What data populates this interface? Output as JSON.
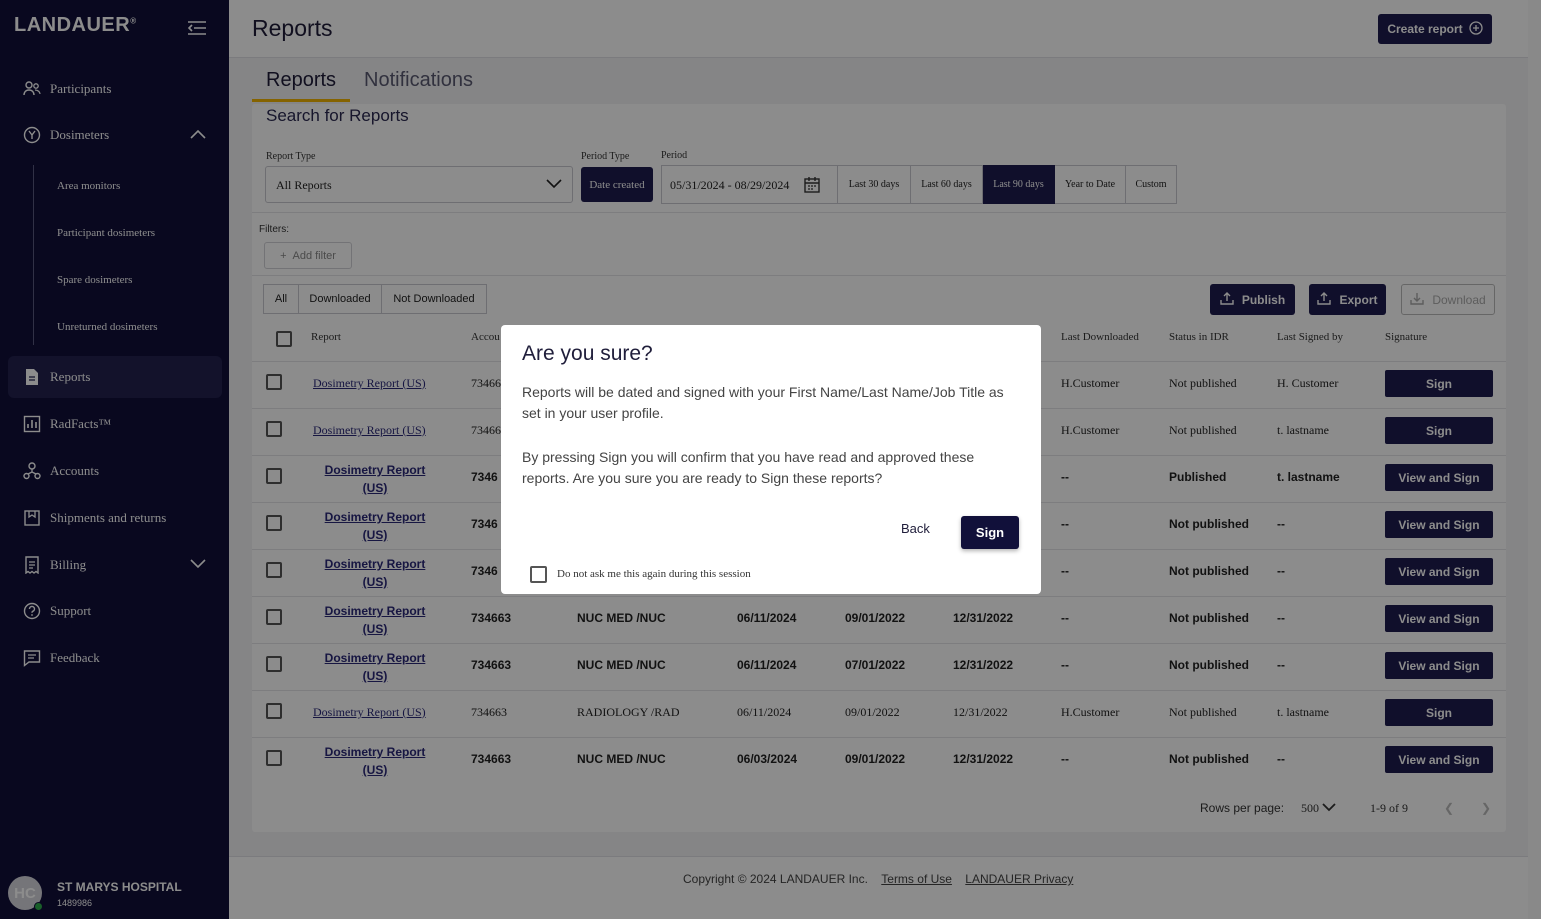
{
  "sidebar": {
    "logo": "LANDAUER",
    "logo_mark": "®",
    "items": [
      {
        "label": "Participants",
        "icon": "participants-icon"
      },
      {
        "label": "Dosimeters",
        "icon": "dosimeter-icon"
      },
      {
        "label": "Reports",
        "icon": "report-icon"
      },
      {
        "label": "RadFacts™",
        "icon": "chart-icon"
      },
      {
        "label": "Accounts",
        "icon": "accounts-icon"
      },
      {
        "label": "Shipments and returns",
        "icon": "shipment-icon"
      },
      {
        "label": "Billing",
        "icon": "billing-icon"
      },
      {
        "label": "Support",
        "icon": "help-icon"
      },
      {
        "label": "Feedback",
        "icon": "feedback-icon"
      }
    ],
    "dosimeter_sub": [
      "Area monitors",
      "Participant dosimeters",
      "Spare dosimeters",
      "Unreturned dosimeters"
    ],
    "user": {
      "initials": "HC",
      "name": "ST MARYS HOSPITAL",
      "id": "1489986"
    }
  },
  "header": {
    "title": "Reports",
    "create_label": "Create report"
  },
  "tabs": [
    "Reports",
    "Notifications"
  ],
  "search": {
    "title": "Search for Reports",
    "report_type_label": "Report Type",
    "report_type_value": "All Reports",
    "period_type_label": "Period Type",
    "period_type_value": "Date created",
    "period_label": "Period",
    "period_value": "05/31/2024 - 08/29/2024",
    "ranges": [
      "Last 30 days",
      "Last 60 days",
      "Last 90 days",
      "Year to Date",
      "Custom"
    ],
    "selected_range": "Last 90 days",
    "filters_label": "Filters:",
    "add_filter": "Add filter"
  },
  "download_filter": [
    "All",
    "Downloaded",
    "Not Downloaded"
  ],
  "actions": {
    "publish": "Publish",
    "export": "Export",
    "download": "Download"
  },
  "table": {
    "headers": [
      "Report",
      "Accou",
      "Last Downloaded",
      "Status in IDR",
      "Last Signed by",
      "Signature"
    ],
    "rows": [
      {
        "report": "Dosimetry Report (US)",
        "acct": "73466",
        "c3": "",
        "c4": "",
        "c5": "",
        "c6": "",
        "last_dl": "H.Customer",
        "status": "Not published",
        "signed": "H. Customer",
        "action": "Sign",
        "bold": false
      },
      {
        "report": "Dosimetry Report (US)",
        "acct": "73466",
        "c3": "",
        "c4": "",
        "c5": "",
        "c6": "",
        "last_dl": "H.Customer",
        "status": "Not published",
        "signed": "t. lastname",
        "action": "Sign",
        "bold": false
      },
      {
        "report": "Dosimetry Report (US)",
        "acct": "7346",
        "c3": "",
        "c4": "",
        "c5": "",
        "c6": "",
        "last_dl": "--",
        "status": "Published",
        "signed": "t. lastname",
        "action": "View and Sign",
        "bold": true
      },
      {
        "report": "Dosimetry Report (US)",
        "acct": "7346",
        "c3": "",
        "c4": "",
        "c5": "",
        "c6": "",
        "last_dl": "--",
        "status": "Not published",
        "signed": "--",
        "action": "View and Sign",
        "bold": true
      },
      {
        "report": "Dosimetry Report (US)",
        "acct": "7346",
        "c3": "",
        "c4": "",
        "c5": "",
        "c6": "",
        "last_dl": "--",
        "status": "Not published",
        "signed": "--",
        "action": "View and Sign",
        "bold": true
      },
      {
        "report": "Dosimetry Report (US)",
        "acct": "734663",
        "c3": "NUC MED /NUC",
        "c4": "06/11/2024",
        "c5": "09/01/2022",
        "c6": "12/31/2022",
        "last_dl": "--",
        "status": "Not published",
        "signed": "--",
        "action": "View and Sign",
        "bold": true
      },
      {
        "report": "Dosimetry Report (US)",
        "acct": "734663",
        "c3": "NUC MED /NUC",
        "c4": "06/11/2024",
        "c5": "07/01/2022",
        "c6": "12/31/2022",
        "last_dl": "--",
        "status": "Not published",
        "signed": "--",
        "action": "View and Sign",
        "bold": true
      },
      {
        "report": "Dosimetry Report (US)",
        "acct": "734663",
        "c3": "RADIOLOGY /RAD",
        "c4": "06/11/2024",
        "c5": "09/01/2022",
        "c6": "12/31/2022",
        "last_dl": "H.Customer",
        "status": "Not published",
        "signed": "t. lastname",
        "action": "Sign",
        "bold": false
      },
      {
        "report": "Dosimetry Report (US)",
        "acct": "734663",
        "c3": "NUC MED /NUC",
        "c4": "06/03/2024",
        "c5": "09/01/2022",
        "c6": "12/31/2022",
        "last_dl": "--",
        "status": "Not published",
        "signed": "--",
        "action": "View and Sign",
        "bold": true
      }
    ]
  },
  "pagination": {
    "rows_label": "Rows per page:",
    "rows_value": "500",
    "range": "1-9 of 9"
  },
  "footer": {
    "copyright": "Copyright © 2024 LANDAUER Inc.",
    "terms": "Terms of Use",
    "privacy": "LANDAUER Privacy"
  },
  "modal": {
    "title": "Are you sure?",
    "p1": "Reports will be dated and signed with your First Name/Last Name/Job Title as set in your user profile.",
    "p2": "By pressing Sign you will confirm that you have read and approved these reports. Are you sure you are ready to Sign these reports?",
    "back": "Back",
    "sign": "Sign",
    "checkbox_label": "Do not ask me this again during this session"
  }
}
